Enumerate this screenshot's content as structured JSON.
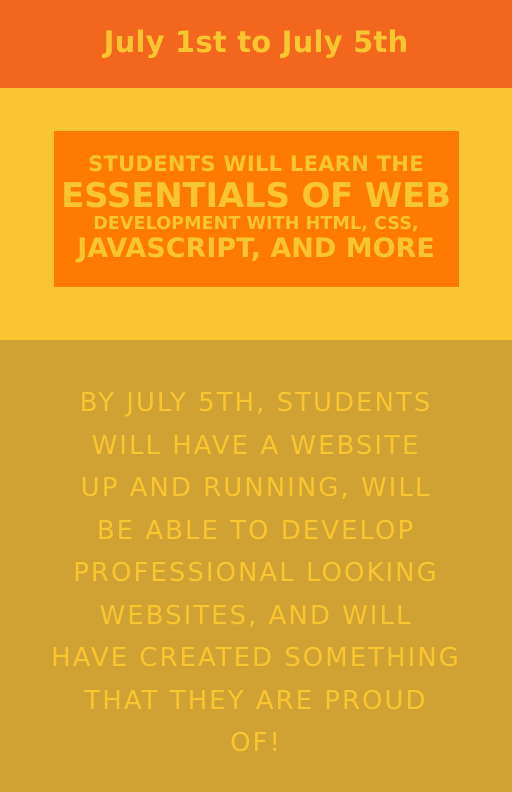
{
  "header": {
    "dates": "July 1st to July 5th"
  },
  "headline": {
    "line1": "Students will learn the",
    "line2": "essentials of web",
    "line3": "development with HTML, CSS,",
    "line4": "JavaScript, and more"
  },
  "outcome": {
    "lines": [
      "By July 5th, students",
      "will have a website",
      "up and running, will",
      "be able to develop",
      "professional looking",
      "websites, and will",
      "have created something",
      "that they are proud",
      "of!"
    ]
  },
  "colors": {
    "top_band": "#f2661d",
    "middle_band": "#f9c531",
    "headline_box": "#ff7a00",
    "bottom_band": "#d0a133",
    "text": "#f9c531"
  }
}
